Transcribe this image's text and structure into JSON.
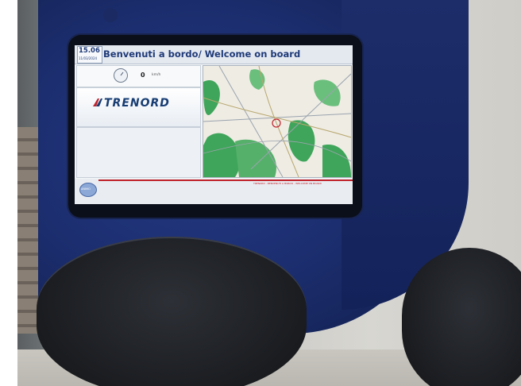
{
  "display": {
    "time": "15.06",
    "date": "11/03/2024",
    "title": "Benvenuti a bordo/ Welcome on board",
    "speed": {
      "value": "0",
      "unit": "km/h",
      "icon": "speedometer-icon"
    },
    "brand": "TRENORD",
    "button_label": "ANIMO",
    "ticker_text": "TRENORD - BENVENUTI A BORDO - WELCOME ON BOARD"
  },
  "colors": {
    "panel": "#1b2d6d",
    "title_text": "#1f3a78",
    "accent_red": "#c0232b",
    "map_green": "#3fa55a"
  }
}
